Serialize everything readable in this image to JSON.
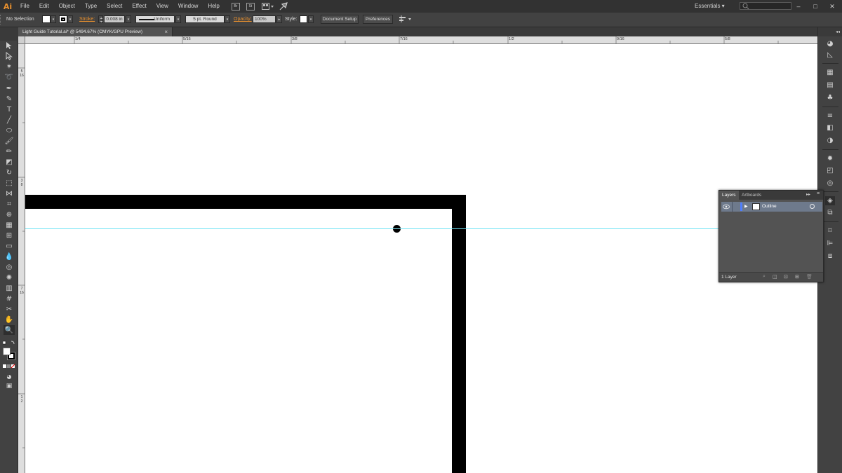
{
  "app": {
    "logo": "Ai",
    "workspace": "Essentials ▾",
    "window_controls": [
      "–",
      "□",
      "✕"
    ]
  },
  "menu": {
    "items": [
      "File",
      "Edit",
      "Object",
      "Type",
      "Select",
      "Effect",
      "View",
      "Window",
      "Help"
    ],
    "bridge": "Br",
    "stock": "St"
  },
  "control_bar": {
    "selection": "No Selection",
    "stroke_label": "Stroke:",
    "stroke_value": "0.008 in",
    "profile": "Uniform",
    "brush": "5 pt. Round",
    "opacity_label": "Opacity:",
    "opacity_value": "100%",
    "style_label": "Style:",
    "doc_setup": "Document Setup",
    "preferences": "Preferences"
  },
  "document_tab": {
    "title": "Light Guide Tutorial.ai* @ 5494.67% (CMYK/GPU Preview)",
    "close": "×"
  },
  "ruler": {
    "horizontal": [
      "1/4",
      "5/16",
      "3/8",
      "7/16",
      "1/2",
      "9/16",
      "5/8"
    ],
    "vertical": [
      "5\n16",
      "3\n8",
      "7\n16",
      "1\n2"
    ]
  },
  "layers_panel": {
    "tabs": [
      "Layers",
      "Artboards"
    ],
    "layer_name": "Outline",
    "count": "1 Layer"
  },
  "colors": {
    "accent": "#e8902e",
    "guide": "#6fe3f5",
    "selection_row": "#6e7a8c",
    "layer_color": "#4f7fff"
  }
}
